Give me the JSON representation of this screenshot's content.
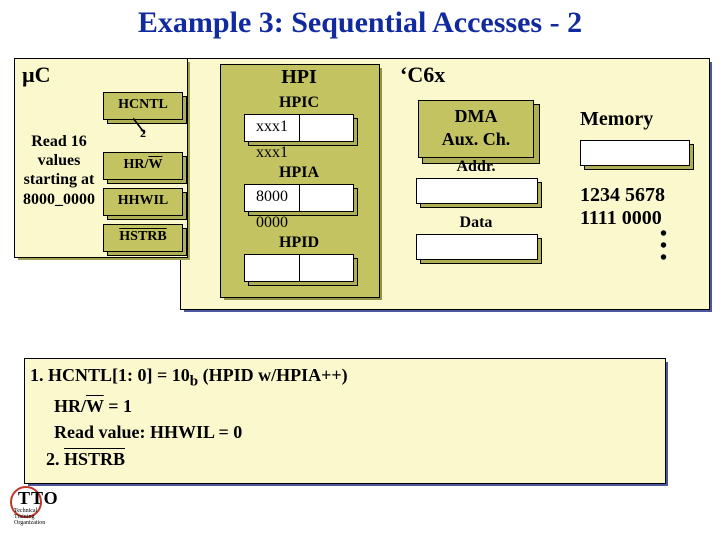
{
  "title": "Example 3: Sequential Accesses - 2",
  "uC": {
    "label": "µC"
  },
  "left_desc": {
    "l1": "Read 16",
    "l2": "values",
    "l3": "starting at",
    "l4": "8000_0000"
  },
  "pins": {
    "hcntl": "HCNTL",
    "hcntl_sub": "2",
    "hrw": "HR/W",
    "hhwil": "HHWIL",
    "hstrb": "HSTRB"
  },
  "hpi": {
    "title": "HPI",
    "hpic_label": "HPIC",
    "hpic_left": "xxx1",
    "hpic_right": "xxx1",
    "hpia_label": "HPIA",
    "hpia_left": "8000",
    "hpia_right": "0000",
    "hpid_label": "HPID"
  },
  "c6x_label": "‘C6x",
  "dma": {
    "l1": "DMA",
    "l2": "Aux. Ch."
  },
  "addr_label": "Addr.",
  "data_label": "Data",
  "memory": {
    "title": "Memory",
    "v1": "1234 5678",
    "v2": "1111 0000"
  },
  "steps": {
    "s1": "1. HCNTL[1: 0] = 10",
    "s1b": " (HPID w/HPIA++)",
    "s1_sub": "b",
    "s2": "HR/W = 1",
    "s3": "Read value: HHWIL = 0",
    "s4": "2. HSTRB"
  },
  "tto": {
    "main": "TTO",
    "sub1": "Technical",
    "sub2": "Training",
    "sub3": "Organization"
  }
}
